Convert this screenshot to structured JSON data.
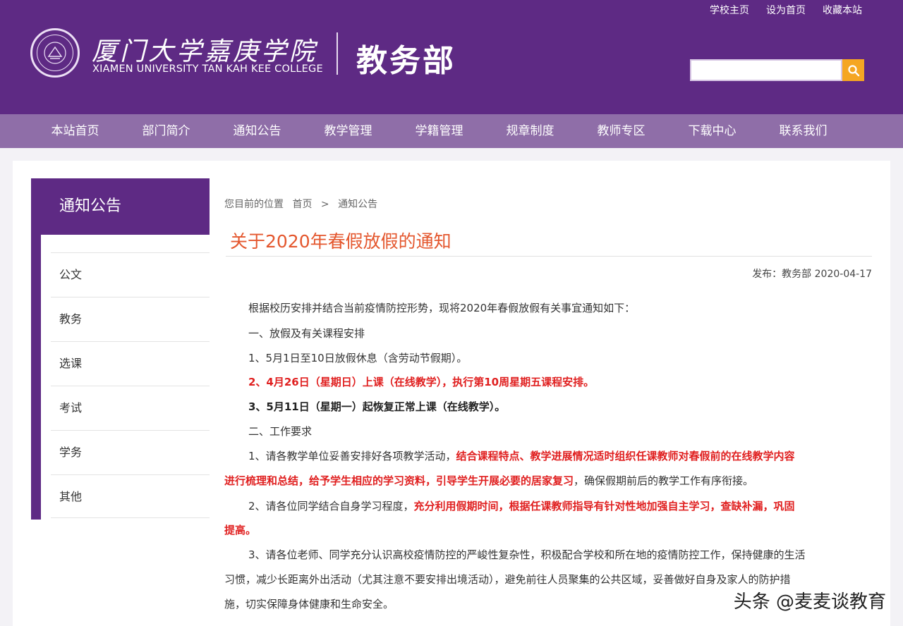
{
  "header": {
    "toplinks": [
      "学校主页",
      "设为首页",
      "收藏本站"
    ],
    "logo_cn": "厦门大学嘉庚学院",
    "logo_en": "XIAMEN UNIVERSITY TAN KAH KEE COLLEGE",
    "dept": "教务部",
    "search_placeholder": "",
    "search_icon": "search-icon",
    "seal_icon": "college-seal-icon"
  },
  "nav": [
    "本站首页",
    "部门简介",
    "通知公告",
    "教学管理",
    "学籍管理",
    "规章制度",
    "教师专区",
    "下载中心",
    "联系我们"
  ],
  "sidebar": {
    "title": "通知公告",
    "items": [
      "公文",
      "教务",
      "选课",
      "考试",
      "学务",
      "其他"
    ]
  },
  "breadcrumb": {
    "label": "您目前的位置",
    "home": "首页",
    "sep": ">",
    "current": "通知公告"
  },
  "article": {
    "title": "关于2020年春假放假的通知",
    "meta": "发布：教务部  2020-04-17",
    "intro": "根据校历安排并结合当前疫情防控形势，现将2020年春假放假有关事宜通知如下：",
    "s1": "一、放假及有关课程安排",
    "i1": "1、5月1日至10日放假休息（含劳动节假期）。",
    "i2": "2、4月26日（星期日）上课（在线教学），执行第10周星期五课程安排。",
    "i3": "3、5月11日（星期一）起恢复正常上课（在线教学）。",
    "s2": "二、工作要求",
    "r1a": "1、请各教学单位妥善安排好各项教学活动，",
    "r1b": "结合课程特点、教学进展情况适时组织任课教师对春假前的在线教学内容",
    "r1c": "进行梳理和总结，给予学生相应的学习资料，引导学生开展必要的居家复习",
    "r1d": "，确保假期前后的教学工作有序衔接。",
    "r2a": "2、请各位同学结合自身学习程度，",
    "r2b": "充分利用假期时间，根据任课教师指导有针对性地加强自主学习，查缺补漏，巩固",
    "r2c": "提高。",
    "r3a": "3、请各位老师、同学充分认识高校疫情防控的严峻性复杂性，积极配合学校和所在地的疫情防控工作，保持健康的生活",
    "r3b": "习惯，减少长距离外出活动（尤其注意不要安排出境活动），避免前往人员聚集的公共区域，妥善做好自身及家人的防护措",
    "r3c": "施，切实保障身体健康和生命安全。"
  },
  "watermark": "头条 @麦麦谈教育",
  "colors": {
    "brand_purple": "#5e2a84",
    "nav_purple": "#8f6ea8",
    "title_orange": "#e4572e",
    "highlight_red": "#e02020",
    "search_orange": "#f5a623"
  }
}
